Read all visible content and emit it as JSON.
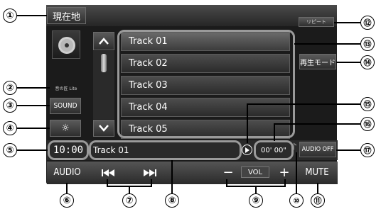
{
  "header": {
    "current_location": "現在地",
    "repeat": "リピート"
  },
  "left": {
    "sub_label": "音の匠 Lite",
    "sound": "SOUND",
    "brightness_icon": "sun-icon"
  },
  "track_list": {
    "tracks": [
      "Track 01",
      "Track 02",
      "Track 03",
      "Track 04",
      "Track 05"
    ],
    "up_icon": "chevron-up-icon",
    "down_icon": "chevron-down-icon"
  },
  "right": {
    "play_mode": "再生モード",
    "audio_off": "AUDIO OFF"
  },
  "status": {
    "clock": "10:00",
    "now_playing": "Track 01",
    "elapsed": "00' 00\""
  },
  "bottom": {
    "audio": "AUDIO",
    "prev_icon": "skip-back-icon",
    "next_icon": "skip-forward-icon",
    "vol_minus": "−",
    "vol_label": "VOL",
    "vol_plus": "+",
    "mute": "MUTE"
  },
  "callouts": [
    "①",
    "②",
    "③",
    "④",
    "⑤",
    "⑥",
    "⑦",
    "⑧",
    "⑨",
    "⑩",
    "⑪",
    "⑫",
    "⑬",
    "⑭",
    "⑮",
    "⑯",
    "⑰"
  ]
}
